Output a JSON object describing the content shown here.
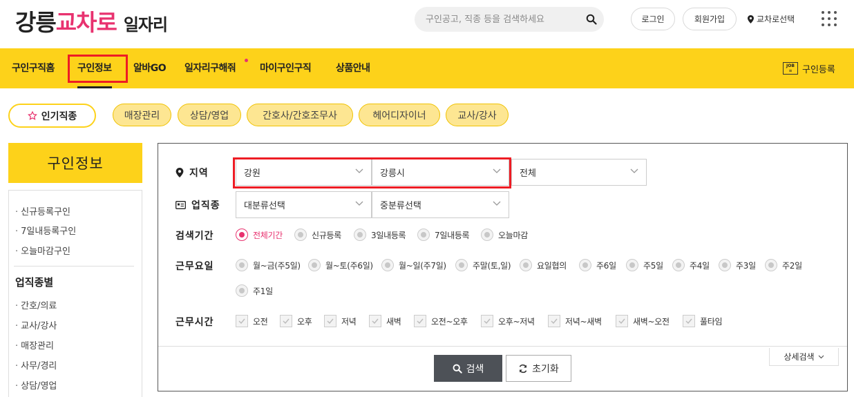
{
  "header": {
    "logo": {
      "part1": "강릉",
      "part2": "교차로",
      "part3": "일자리"
    },
    "search_placeholder": "구인공고, 직종 등을 검색하세요",
    "login": "로그인",
    "signup": "회원가입",
    "region_select": "교차로선택"
  },
  "nav": {
    "items": [
      {
        "label": "구인구직홈"
      },
      {
        "label": "구인정보"
      },
      {
        "label": "알바GO"
      },
      {
        "label": "일자리구해줘"
      },
      {
        "label": "마이구인구직"
      },
      {
        "label": "상품안내"
      }
    ],
    "register_icon_text": "JOB",
    "register": "구인등록"
  },
  "popular": {
    "main": "인기직종",
    "chips": [
      "매장관리",
      "상담/영업",
      "간호사/간호조무사",
      "헤어디자이너",
      "교사/강사"
    ]
  },
  "sidebar": {
    "title": "구인정보",
    "links": [
      "신규등록구인",
      "7일내등록구인",
      "오늘마감구인"
    ],
    "section_title": "업직종별",
    "job_links": [
      "간호/의료",
      "교사/강사",
      "매장관리",
      "사무/경리",
      "상담/영업"
    ]
  },
  "filters": {
    "region": {
      "label": "지역",
      "province": "강원",
      "city": "강릉시",
      "district": "전체"
    },
    "industry": {
      "label": "업직종",
      "major": "대분류선택",
      "minor": "중분류선택"
    },
    "period": {
      "label": "검색기간",
      "options": [
        "전체기간",
        "신규등록",
        "3일내등록",
        "7일내등록",
        "오늘마감"
      ],
      "selected": "전체기간"
    },
    "workdays": {
      "label": "근무요일",
      "options": [
        "월~금(주5일)",
        "월~토(주6일)",
        "월~일(주7일)",
        "주말(토,일)",
        "요일협의",
        "주6일",
        "주5일",
        "주4일",
        "주3일",
        "주2일",
        "주1일"
      ]
    },
    "worktime": {
      "label": "근무시간",
      "options": [
        "오전",
        "오후",
        "저녁",
        "새벽",
        "오전~오후",
        "오후~저녁",
        "저녁~새벽",
        "새벽~오전",
        "풀타임"
      ]
    }
  },
  "actions": {
    "search": "검색",
    "reset": "초기화",
    "detail": "상세검색"
  },
  "colors": {
    "accent_yellow": "#fdd21a",
    "brand_pink": "#e8326f",
    "highlight_red": "#ee1c24"
  }
}
